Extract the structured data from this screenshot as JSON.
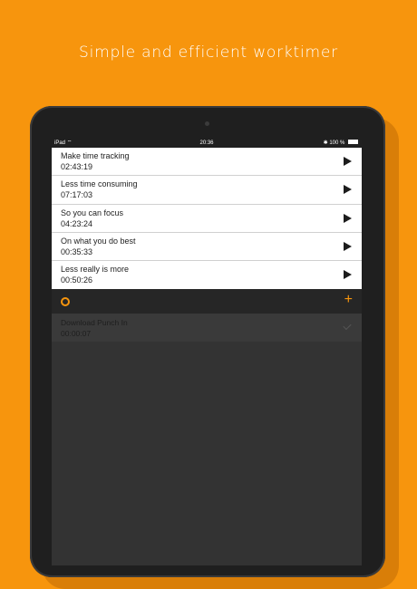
{
  "headline": "Simple and efficient worktimer",
  "status_bar": {
    "device": "iPad",
    "time": "20:36",
    "battery": "100 %"
  },
  "tasks": [
    {
      "name": "Make time tracking",
      "time": "02:43:19"
    },
    {
      "name": "Less time consuming",
      "time": "07:17:03"
    },
    {
      "name": "So you can focus",
      "time": "04:23:24"
    },
    {
      "name": "On what you do best",
      "time": "00:35:33"
    },
    {
      "name": "Less really is more",
      "time": "00:50:26"
    }
  ],
  "toolbar": {
    "left_icon": "ring-icon",
    "add_label": "+"
  },
  "completed": [
    {
      "name": "Download Punch In",
      "time": "00:00:07"
    }
  ],
  "colors": {
    "accent": "#f7950d",
    "device_frame": "#1f1f1f",
    "screen_background": "#333333"
  }
}
